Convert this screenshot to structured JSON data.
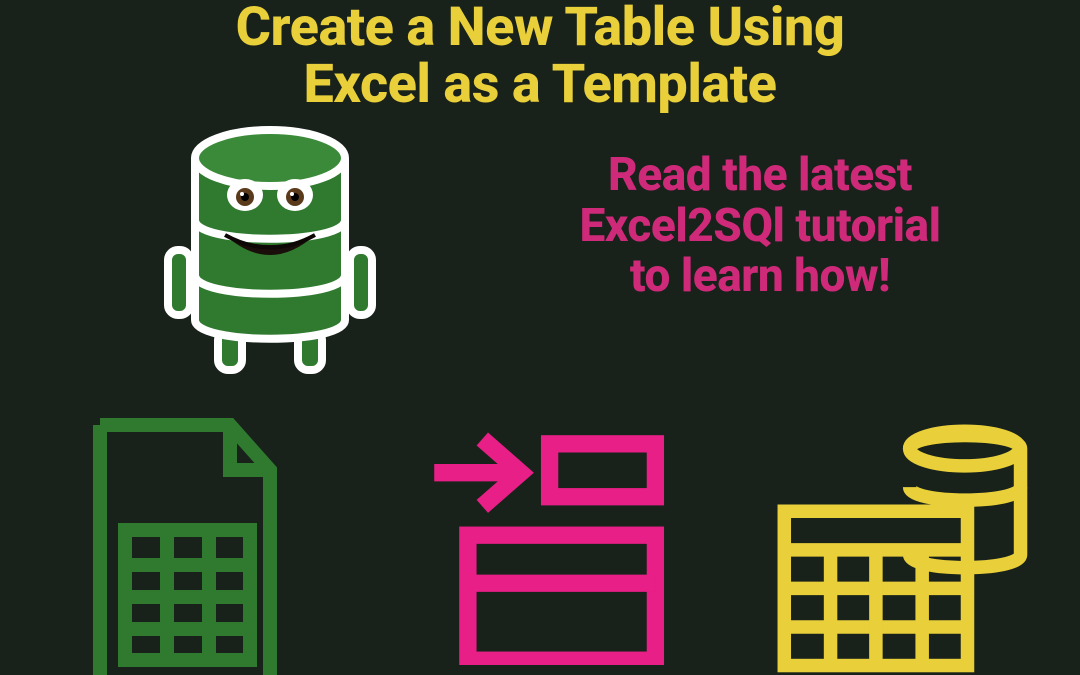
{
  "title_line1": "Create a New Table Using",
  "title_line2": "Excel as a Template",
  "subtitle_line1": "Read the latest",
  "subtitle_line2": "Excel2SQl tutorial",
  "subtitle_line3": "to learn how!",
  "colors": {
    "bg": "#18221a",
    "yellow": "#e9cf3a",
    "pink": "#cf2a7a",
    "green": "#2f7a2f",
    "darkgreen": "#1f5a1f"
  }
}
